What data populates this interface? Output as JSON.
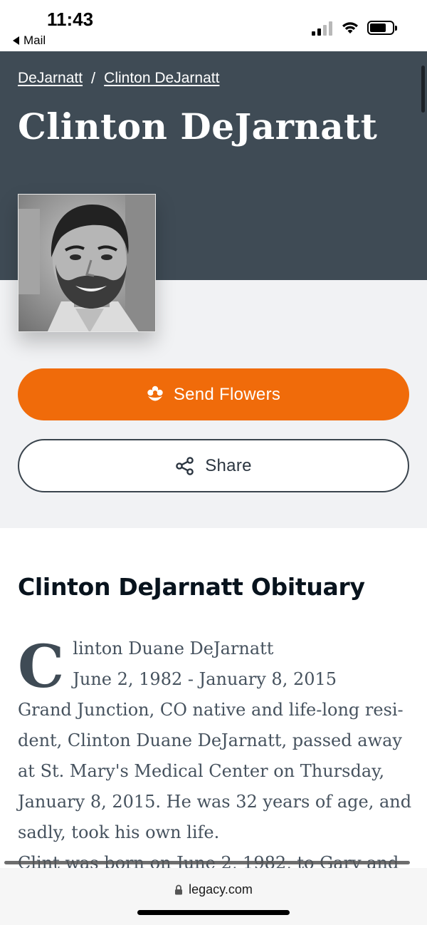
{
  "status_bar": {
    "time": "11:43",
    "back_label": "Mail"
  },
  "breadcrumb": {
    "items": [
      "DeJarnatt",
      "Clinton DeJarnatt"
    ],
    "separator": "/"
  },
  "header": {
    "title": "Clinton DeJarnatt"
  },
  "actions": {
    "send_flowers_label": "Send Flowers",
    "share_label": "Share"
  },
  "obituary": {
    "heading": "Clinton DeJarnatt Obituary",
    "dropcap": "C",
    "line1": "linton Duane DeJarnatt",
    "line2": "June 2, 1982 - January 8, 2015",
    "paragraph1": "Grand Junction, CO native and life-long resi-dent, Clinton Duane DeJarnatt, passed away at St. Mary's Medical Center on Thursday, January 8, 2015. He was 32 years of age, and sadly, took his own life.",
    "paragraph2": "Clint was born on June 2, 1982, to Gary and"
  },
  "browser": {
    "url": "legacy.com"
  },
  "colors": {
    "header_bg": "#3f4b55",
    "accent_orange": "#f06b0a",
    "light_bg": "#f1f2f4"
  },
  "icons": [
    "signal-icon",
    "wifi-icon",
    "battery-icon",
    "flower-icon",
    "share-icon",
    "lock-icon"
  ]
}
